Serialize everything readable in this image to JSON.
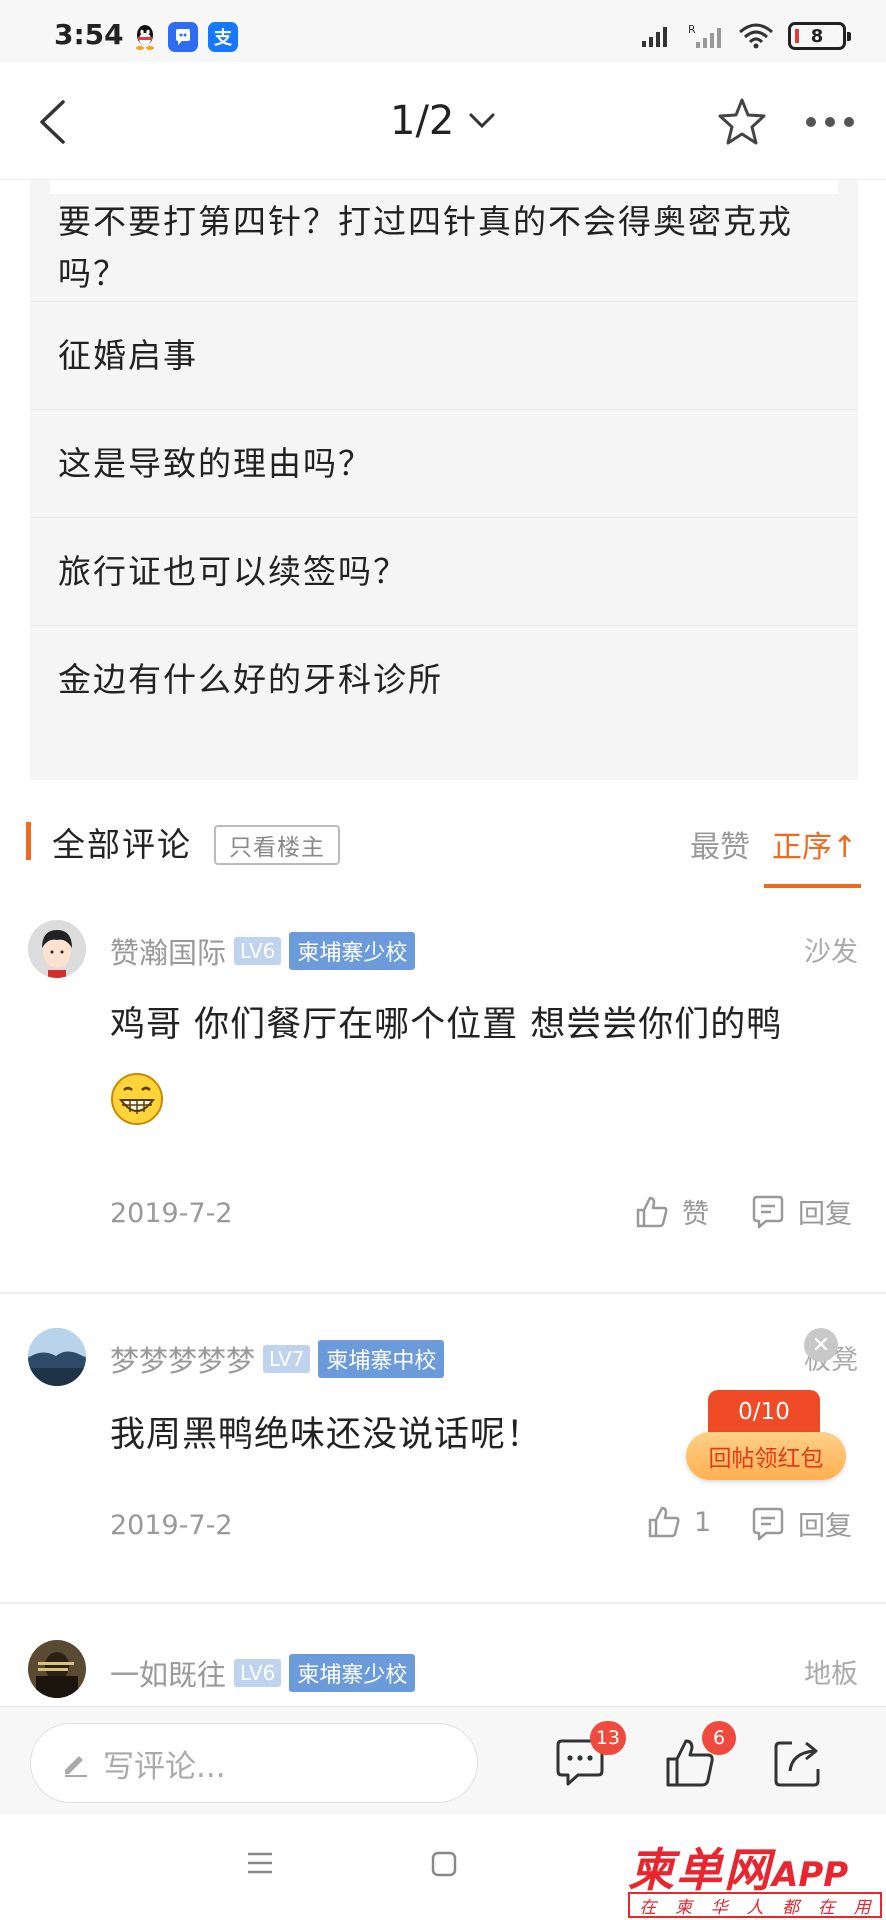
{
  "status_bar": {
    "time": "3:54",
    "battery": "8",
    "icons": [
      "qq-icon",
      "chat-app-icon",
      "alipay-icon",
      "signal-icon",
      "signal-r-icon",
      "wifi-icon",
      "battery-icon"
    ]
  },
  "nav": {
    "page_indicator": "1/2",
    "icons": [
      "back-arrow-icon",
      "chevron-down-icon",
      "star-icon",
      "more-icon"
    ]
  },
  "related_posts": [
    "要不要打第四针？打过四针真的不会得奥密克戎吗？",
    "征婚启事",
    "这是导致的理由吗？",
    "旅行证也可以续签吗？",
    "金边有什么好的牙科诊所"
  ],
  "comments_header": {
    "title": "全部评论",
    "only_op": "只看楼主",
    "sort_best": "最赞",
    "sort_order": "正序↑"
  },
  "comments": [
    {
      "user": "赞瀚国际",
      "level": "LV6",
      "school": "柬埔寨少校",
      "floor": "沙发",
      "text": "鸡哥  你们餐厅在哪个位置 想尝尝你们的鸭",
      "date": "2019-7-2",
      "like_label": "赞",
      "reply_label": "回复"
    },
    {
      "user": "梦梦梦梦梦",
      "level": "LV7",
      "school": "柬埔寨中校",
      "floor": "板凳",
      "text": "我周黑鸭绝味还没说话呢！",
      "date": "2019-7-2",
      "like_label": "1",
      "reply_label": "回复"
    },
    {
      "user": "一如既往",
      "level": "LV6",
      "school": "柬埔寨少校",
      "floor": "地板"
    }
  ],
  "red_packet": {
    "count": "0/10",
    "label": "回帖领红包"
  },
  "bottom_bar": {
    "placeholder": "写评论...",
    "comment_badge": "13",
    "like_badge": "6"
  },
  "watermark": {
    "main": "柬单网",
    "app": "APP",
    "sub": [
      "在",
      "柬",
      "华",
      "人",
      "都",
      "在",
      "用"
    ]
  }
}
